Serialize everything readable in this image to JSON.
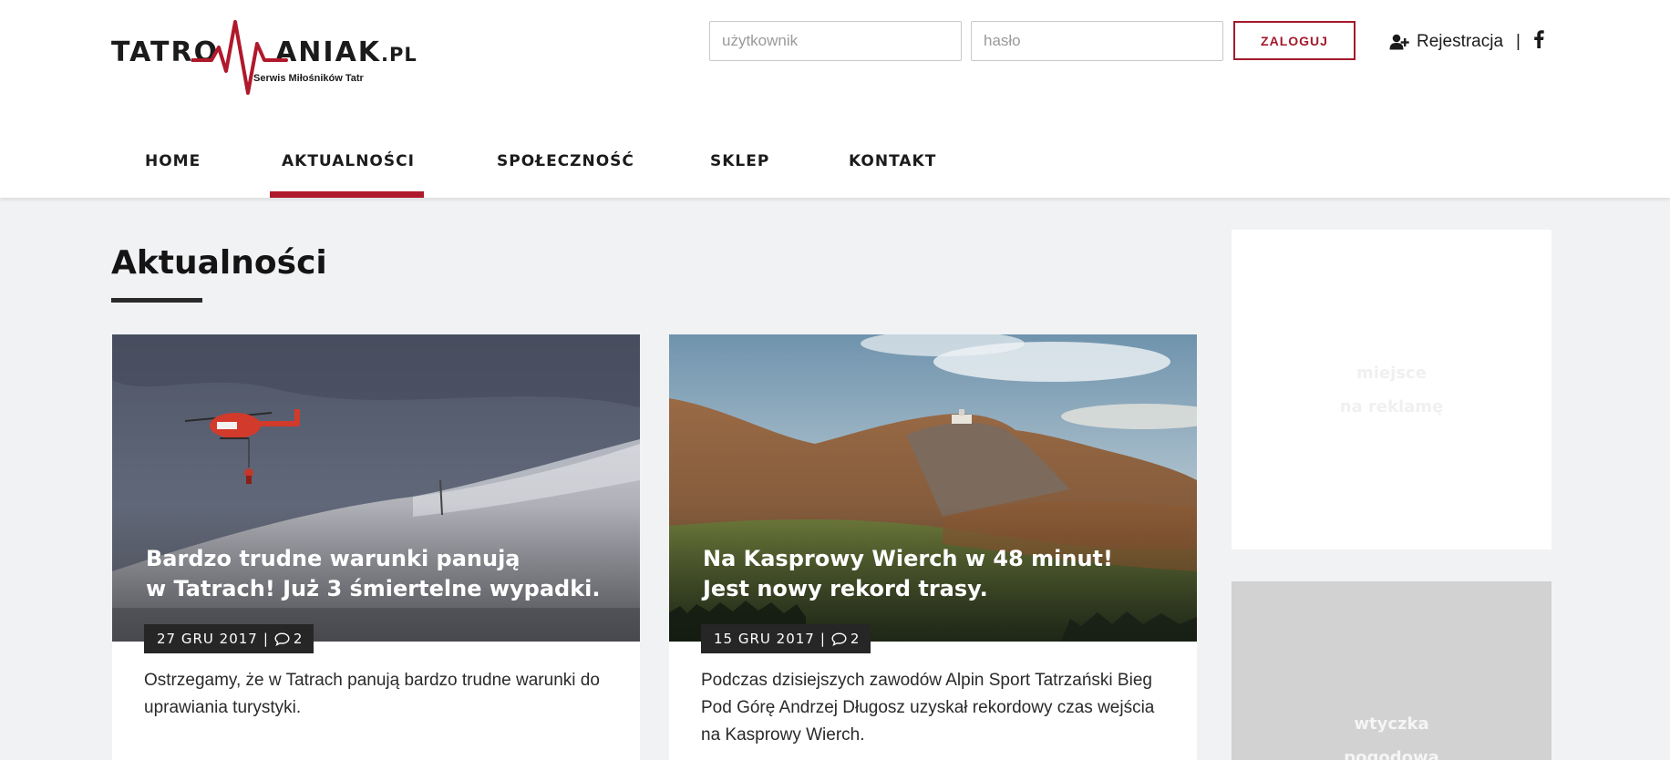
{
  "logo": {
    "name_left": "TATRO",
    "name_right": "ANIAK",
    "domain": ".PL",
    "tagline": "Serwis Miłośników Tatr"
  },
  "login": {
    "username_placeholder": "użytkownik",
    "password_placeholder": "hasło",
    "submit_label": "ZALOGUJ",
    "register_label": "Rejestracja",
    "separator": "|"
  },
  "nav": {
    "items": [
      {
        "label": "HOME"
      },
      {
        "label": "AKTUALNOŚCI",
        "active": true
      },
      {
        "label": "SPOŁECZNOŚĆ"
      },
      {
        "label": "SKLEP"
      },
      {
        "label": "KONTAKT"
      }
    ]
  },
  "main": {
    "title": "Aktualności",
    "articles": [
      {
        "title": "Bardzo trudne warunki panują\nw Tatrach!  Już 3 śmiertelne wypadki.",
        "date": "27 GRU 2017",
        "comments": "2",
        "excerpt": "Ostrzegamy, że w Tatrach panują bardzo trudne warunki do uprawiania turystyki."
      },
      {
        "title": "Na Kasprowy Wierch w 48 minut!\n Jest nowy rekord trasy.",
        "date": "15 GRU 2017",
        "comments": "2",
        "excerpt": "Podczas dzisiejszych zawodów Alpin Sport Tatrzański Bieg Pod Górę Andrzej Długosz uzyskał rekordowy czas wejścia na Kasprowy Wierch."
      }
    ],
    "meta_separator": "|"
  },
  "sidebar": {
    "ad_line1": "miejsce",
    "ad_line2": "na reklamę",
    "weather_line1": "wtyczka",
    "weather_line2": "pogodowa"
  },
  "colors": {
    "accent": "#b0182b",
    "button_border": "#a3192a",
    "page_bg": "#f1f2f4",
    "meta_bg": "#262626"
  },
  "icons": {
    "register": "user-plus-icon",
    "social": "facebook-icon",
    "comments": "comment-icon",
    "logo_mark": "heartbeat-m-icon"
  }
}
